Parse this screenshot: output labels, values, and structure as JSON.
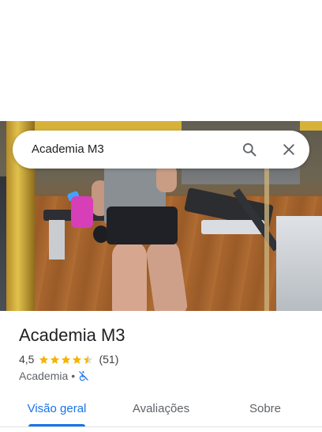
{
  "search": {
    "query": "Academia M3"
  },
  "place": {
    "name": "Academia M3",
    "rating": "4,5",
    "stars_filled": 4.5,
    "reviews": "(51)",
    "category": "Academia",
    "separator": "•"
  },
  "tabs": [
    {
      "label": "Visão geral",
      "active": true
    },
    {
      "label": "Avaliações",
      "active": false
    },
    {
      "label": "Sobre",
      "active": false
    }
  ],
  "colors": {
    "accent": "#1a73e8",
    "star": "#f4b400"
  }
}
